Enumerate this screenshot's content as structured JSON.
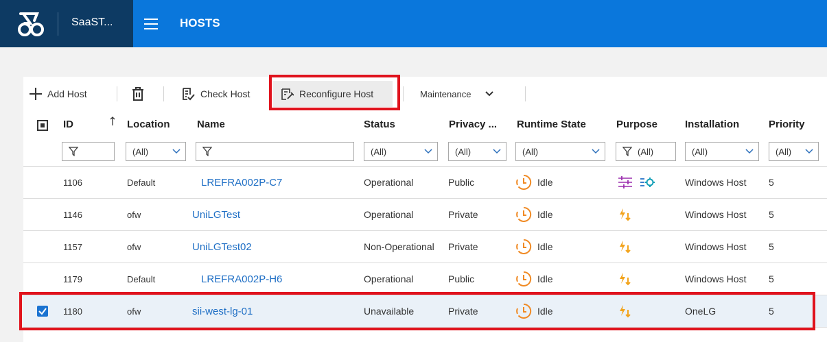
{
  "app": {
    "name": "SaaST...",
    "title": "HOSTS"
  },
  "toolbar": {
    "add_host": "Add Host",
    "check_host": "Check Host",
    "reconfigure_host": "Reconfigure Host",
    "maintenance": "Maintenance"
  },
  "columns": {
    "id": "ID",
    "location": "Location",
    "name": "Name",
    "status": "Status",
    "privacy": "Privacy ...",
    "runtime": "Runtime State",
    "purpose": "Purpose",
    "installation": "Installation",
    "priority": "Priority"
  },
  "filters": {
    "location": "(All)",
    "status": "(All)",
    "privacy": "(All)",
    "runtime": "(All)",
    "purpose": "(All)",
    "installation": "(All)",
    "priority": "(All)"
  },
  "rows": [
    {
      "id": "1106",
      "location": "Default",
      "name": "LREFRA002P-C7",
      "status": "Operational",
      "privacy": "Public",
      "runtime": "Idle",
      "installation": "Windows Host",
      "priority": "5"
    },
    {
      "id": "1146",
      "location": "ofw",
      "name": "UniLGTest",
      "status": "Operational",
      "privacy": "Private",
      "runtime": "Idle",
      "installation": "Windows Host",
      "priority": "5"
    },
    {
      "id": "1157",
      "location": "ofw",
      "name": "UniLGTest02",
      "status": "Non-Operational",
      "privacy": "Private",
      "runtime": "Idle",
      "installation": "Windows Host",
      "priority": "5"
    },
    {
      "id": "1179",
      "location": "Default",
      "name": "LREFRA002P-H6",
      "status": "Operational",
      "privacy": "Public",
      "runtime": "Idle",
      "installation": "Windows Host",
      "priority": "5"
    },
    {
      "id": "1180",
      "location": "ofw",
      "name": "sii-west-lg-01",
      "status": "Unavailable",
      "privacy": "Private",
      "runtime": "Idle",
      "installation": "OneLG",
      "priority": "5"
    }
  ],
  "colors": {
    "topbar": "#0a77dc",
    "brand": "#0d3a63",
    "link": "#1f6fc5",
    "highlight": "#e0131d",
    "idle_icon": "#f08a24"
  }
}
